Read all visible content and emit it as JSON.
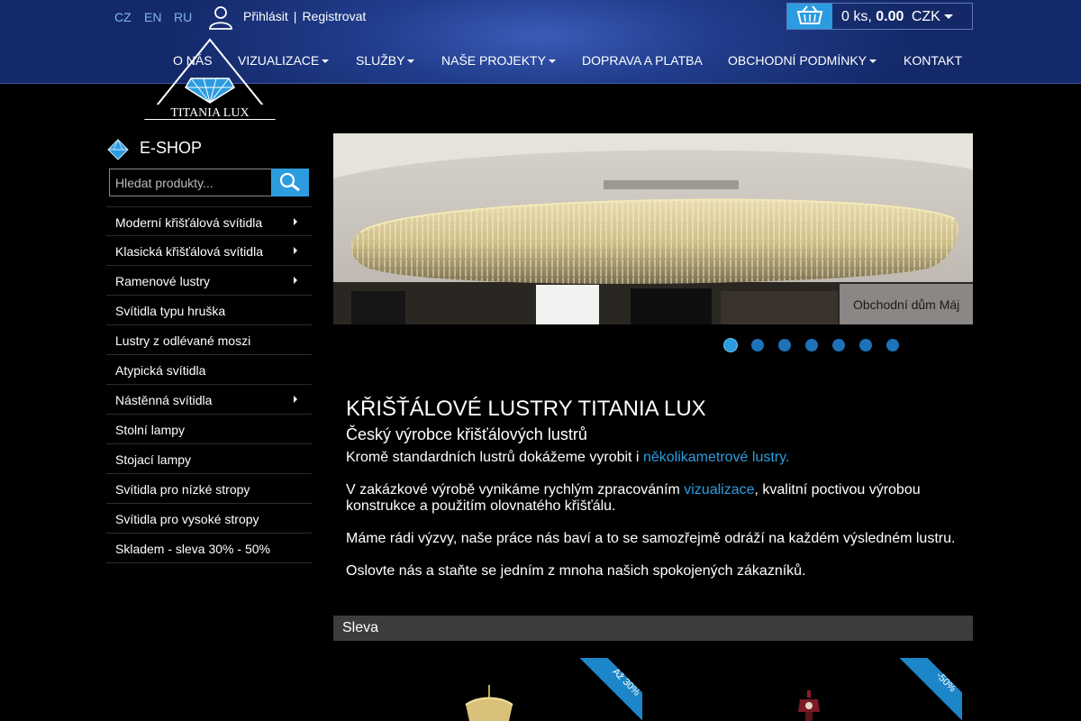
{
  "header": {
    "languages": [
      "CZ",
      "EN",
      "RU"
    ],
    "login": "Přihlásit",
    "separator": "|",
    "register": "Registrovat",
    "cart": {
      "count": "0 ks,",
      "total": "0.00",
      "currency": "CZK"
    },
    "nav": [
      {
        "label": "O NÁS",
        "dropdown": false
      },
      {
        "label": "VIZUALIZACE",
        "dropdown": true
      },
      {
        "label": "SLUŽBY",
        "dropdown": true
      },
      {
        "label": "NAŠE PROJEKTY",
        "dropdown": true
      },
      {
        "label": "DOPRAVA A PLATBA",
        "dropdown": false
      },
      {
        "label": "OBCHODNÍ PODMÍNKY",
        "dropdown": true
      },
      {
        "label": "KONTAKT",
        "dropdown": false
      }
    ],
    "logo_text": "TITANIA LUX"
  },
  "sidebar": {
    "title": "E-SHOP",
    "search_placeholder": "Hledat produkty...",
    "items": [
      {
        "label": "Moderní křišťálová svítidla",
        "submenu": true
      },
      {
        "label": "Klasická křišťálová svítidla",
        "submenu": true
      },
      {
        "label": "Ramenové lustry",
        "submenu": true
      },
      {
        "label": "Svítidla typu hruška",
        "submenu": false
      },
      {
        "label": "Lustry z odlévané moszi",
        "submenu": false
      },
      {
        "label": "Atypická svítidla",
        "submenu": false
      },
      {
        "label": "Nástěnná svítidla",
        "submenu": true
      },
      {
        "label": "Stolní lampy",
        "submenu": false
      },
      {
        "label": "Stojací lampy",
        "submenu": false
      },
      {
        "label": "Svítidla pro nízké stropy",
        "submenu": false
      },
      {
        "label": "Svítidla pro vysoké stropy",
        "submenu": false
      },
      {
        "label": "Skladem - sleva 30% - 50%",
        "submenu": false
      }
    ]
  },
  "slider": {
    "caption": "Obchodní dům Máj",
    "slide_count": 7,
    "active_index": 0
  },
  "content": {
    "title": "KŘIŠŤÁLOVÉ LUSTRY TITANIA LUX",
    "subtitle": "Český výrobce křišťálových lustrů",
    "p1_text": "Kromě standardních lustrů dokážeme vyrobit i ",
    "p1_link": "několikametrové lustry.",
    "p2_text": "V zakázkové výrobě vynikáme rychlým zpracováním ",
    "p2_link": "vizualizace",
    "p2_rest": ", kvalitní poctivou výrobou konstrukce a použitím olovnatého křišťálu.",
    "p3": "Máme rádi výzvy, naše práce nás baví a to se samozřejmě odráží na každém výsledném lustru.",
    "p4": "Oslovte nás a staňte se jedním z mnoha našich spokojených zákazníků."
  },
  "sale": {
    "title": "Sleva",
    "products": [
      {
        "badge": "Až 30%"
      },
      {
        "badge": "-50%"
      }
    ]
  },
  "colors": {
    "accent": "#2c9ce0",
    "header": "#213d8c",
    "bar": "#3c3c3c"
  }
}
